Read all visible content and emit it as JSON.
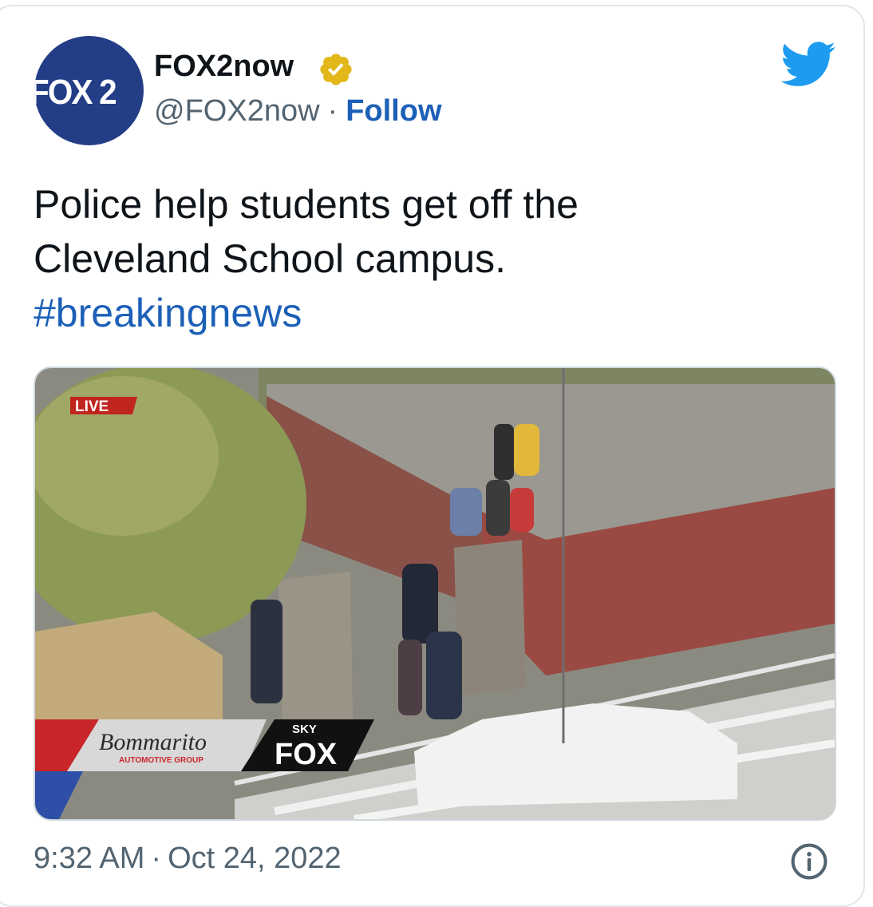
{
  "author": {
    "avatar_text": "FOX 2",
    "display_name": "FOX2now",
    "handle": "@FOX2now",
    "separator": "·",
    "follow_label": "Follow"
  },
  "icons": {
    "verified": "verified-badge-icon",
    "platform": "twitter-bird-icon",
    "info": "info-icon"
  },
  "tweet": {
    "line1": "Police help students get off the",
    "line2": "Cleveland School campus.",
    "hashtag": "#breakingnews"
  },
  "media": {
    "live_badge": "LIVE",
    "sponsor_name": "Bommarito",
    "sponsor_sub": "AUTOMOTIVE GROUP",
    "network_top": "SKY",
    "network_main": "FOX"
  },
  "footer": {
    "time": "9:32 AM",
    "separator": "·",
    "date": "Oct 24, 2022"
  },
  "colors": {
    "link": "#1d60b7",
    "secondary_text": "#536471",
    "twitter_blue": "#1d9bf0",
    "verified_gold": "#e2b719",
    "fox_navy": "#233d87"
  }
}
